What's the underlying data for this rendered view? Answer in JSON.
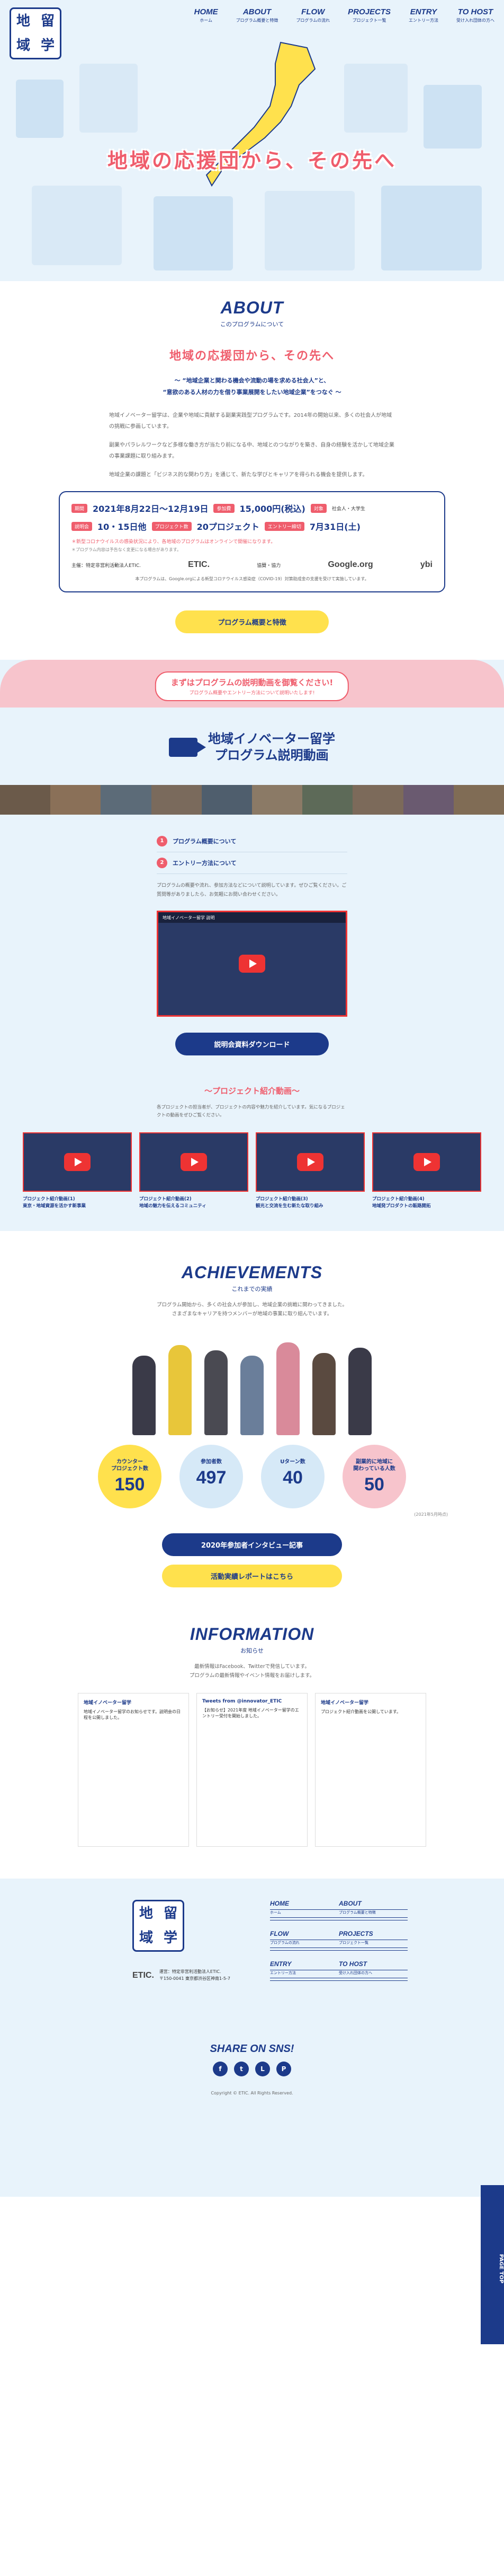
{
  "logo": {
    "chars": [
      "留",
      "地",
      "学",
      "域"
    ]
  },
  "nav": [
    {
      "en": "HOME",
      "jp": "ホーム"
    },
    {
      "en": "ABOUT",
      "jp": "プログラム概要と特徴"
    },
    {
      "en": "FLOW",
      "jp": "プログラムの流れ"
    },
    {
      "en": "PROJECTS",
      "jp": "プロジェクト一覧"
    },
    {
      "en": "ENTRY",
      "jp": "エントリー方法"
    },
    {
      "en": "TO HOST",
      "jp": "受け入れ団体の方へ"
    }
  ],
  "hero": {
    "title": "地域の応援団から、その先へ"
  },
  "about": {
    "title_en": "ABOUT",
    "title_jp": "このプログラムについて",
    "catch": "地域の応援団から、その先へ",
    "lead1": "〜 “地域企業と関わる機会や流動の場を求める社会人”と、",
    "lead2": "“意欲のある人材の力を借り事業展開をしたい地域企業”をつなぐ 〜",
    "body": [
      "地域イノベーター留学は、企業や地域に貢献する副業実践型プログラムです。2014年の開始以来、多くの社会人が地域の挑戦に参画しています。",
      "副業やパラレルワークなど多様な働き方が当たり前になる中、地域とのつながりを築き、自身の経験を活かして地域企業の事業課題に取り組みます。",
      "地域企業の課題と「ビジネス的な関わり方」を通じて、新たな学びとキャリアを得られる機会を提供します。"
    ],
    "info": {
      "period_label": "期間",
      "period": "2021年8月22日〜12月19日",
      "fee_label": "参加費",
      "fee": "15,000円(税込)",
      "target_label": "対象",
      "target": "社会人・大学生",
      "briefing_label": "説明会",
      "briefing": "10・15日他",
      "project_label": "プロジェクト数",
      "projects": "20プロジェクト",
      "deadline_label": "エントリー締切",
      "deadline": "7月31日(土)",
      "note_red": "＊新型コロナウイルスの感染状況により、各地域のプログラムはオンラインで開催になります。",
      "note_grey": "＊プログラム内容は予告なく変更になる場合があります。",
      "organizer": "主催：特定非営利活動法人ETIC.",
      "sponsor": "協賛・協力",
      "etic": "ETIC.",
      "google": "Google.org",
      "ybi": "ybi",
      "foot": "本プログラムは、Google.orgによる新型コロナウイルス感染症（COVID-19）対策助成金の支援を受けて実施しています。"
    },
    "button": "プログラム概要と特徴"
  },
  "video": {
    "banner_title": "まずはプログラムの説明動画を御覧ください!",
    "banner_sub": "プログラム概要やエントリー方法について説明いたします!",
    "title_line1": "地域イノベーター留学",
    "title_line2": "プログラム説明動画",
    "items": [
      {
        "no": "1",
        "label": "プログラム概要について"
      },
      {
        "no": "2",
        "label": "エントリー方法について"
      }
    ],
    "desc": "プログラムの概要や流れ、参加方法などについて説明しています。ぜひご覧ください。ご質問等がありましたら、お気軽にお問い合わせください。",
    "player_title": "地域イノベーター留学 説明",
    "download": "説明会資料ダウンロード",
    "project_head": "〜プロジェクト紹介動画〜",
    "project_desc": "各プロジェクトの担当者が、プロジェクトの内容や魅力を紹介しています。気になるプロジェクトの動画をぜひご覧ください。",
    "projects": [
      "プロジェクト紹介動画(1)\n東京・地域資源を活かす新事業",
      "プロジェクト紹介動画(2)\n地域の魅力を伝えるコミュニティ",
      "プロジェクト紹介動画(3)\n観光と交流を生む新たな取り組み",
      "プロジェクト紹介動画(4)\n地域発プロダクトの販路開拓"
    ]
  },
  "achievements": {
    "title_en": "ACHIEVEMENTS",
    "title_jp": "これまでの実績",
    "lead1": "プログラム開始から、多くの社会人が参加し、地域企業の挑戦に関わってきました。",
    "lead2": "さまざまなキャリアを持つメンバーが地域の事業に取り組んでいます。",
    "stats": [
      {
        "label": "カウンター\nプロジェクト数",
        "value": "150"
      },
      {
        "label": "参加者数",
        "value": "497"
      },
      {
        "label": "Uターン数",
        "value": "40"
      },
      {
        "label": "副業的に地域に\n関わっている人数",
        "value": "50"
      }
    ],
    "note": "(2021年5月時点)",
    "btn1": "2020年参加者インタビュー記事",
    "btn2": "活動実績レポートはこちら"
  },
  "information": {
    "title_en": "INFORMATION",
    "title_jp": "お知らせ",
    "lead1": "最新情報はFacebook、Twitterで発信しています。",
    "lead2": "プログラムの最新情報やイベント情報をお届けします。",
    "widgets": [
      {
        "title": "地域イノベーター留学",
        "body": "地域イノベーター留学のお知らせです。説明会の日程を公開しました。"
      },
      {
        "title": "Tweets from @innovator_ETIC",
        "body": "【お知らせ】2021年度 地域イノベーター留学のエントリー受付を開始しました。"
      },
      {
        "title": "地域イノベーター留学",
        "body": "プロジェクト紹介動画を公開しています。"
      }
    ]
  },
  "footer": {
    "nav": [
      {
        "en": "HOME",
        "jp": "ホーム"
      },
      {
        "en": "ABOUT",
        "jp": "プログラム概要と特徴"
      },
      {
        "en": "FLOW",
        "jp": "プログラムの流れ"
      },
      {
        "en": "PROJECTS",
        "jp": "プロジェクト一覧"
      },
      {
        "en": "ENTRY",
        "jp": "エントリー方法"
      },
      {
        "en": "TO HOST",
        "jp": "受け入れ団体の方へ"
      }
    ],
    "org_name": "運営：特定非営利活動法人ETIC.",
    "org_addr": "〒150-0041 東京都渋谷区神南1-5-7",
    "share": "SHARE ON SNS!",
    "sns": [
      "f",
      "t",
      "L",
      "P"
    ],
    "copyright": "Copyright © ETIC. All Rights Reserved.",
    "pagetop": "PAGE TOP"
  },
  "colors": {
    "navy": "#1c3a8a",
    "pink": "#ef5d6c",
    "yellow": "#ffe14d",
    "sky": "#e8f3fb"
  }
}
